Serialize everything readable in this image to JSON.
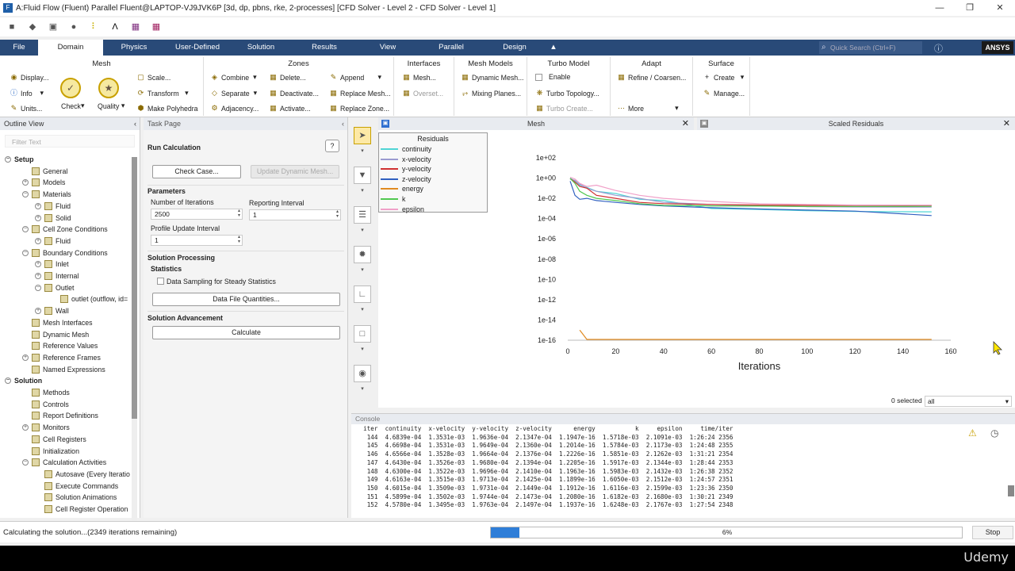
{
  "window": {
    "title": "A:Fluid Flow (Fluent) Parallel Fluent@LAPTOP-VJ9JVK6P  [3d, dp, pbns, rke, 2-processes] [CFD Solver - Level 2 - CFD Solver - Level 1]"
  },
  "tabs": [
    "File",
    "Domain",
    "Physics",
    "User-Defined",
    "Solution",
    "Results",
    "View",
    "Parallel",
    "Design"
  ],
  "active_tab": "Domain",
  "search_placeholder": "Quick Search (Ctrl+F)",
  "brand": "ANSYS",
  "ribbon": {
    "mesh": {
      "title": "Mesh",
      "display": "Display...",
      "info": "Info",
      "units": "Units...",
      "check": "Check",
      "quality": "Quality",
      "scale": "Scale...",
      "transform": "Transform",
      "make_polyhedra": "Make Polyhedra"
    },
    "zones": {
      "title": "Zones",
      "combine": "Combine",
      "separate": "Separate",
      "adjacency": "Adjacency...",
      "delete": "Delete...",
      "deactivate": "Deactivate...",
      "activate": "Activate...",
      "append": "Append",
      "replace_mesh": "Replace Mesh...",
      "replace_zone": "Replace Zone..."
    },
    "interfaces": {
      "title": "Interfaces",
      "mesh": "Mesh...",
      "overset": "Overset..."
    },
    "mesh_models": {
      "title": "Mesh Models",
      "dynamic_mesh": "Dynamic Mesh...",
      "mixing_planes": "Mixing Planes..."
    },
    "turbo": {
      "title": "Turbo Model",
      "enable": "Enable",
      "topology": "Turbo Topology...",
      "create": "Turbo Create..."
    },
    "adapt": {
      "title": "Adapt",
      "refine": "Refine / Coarsen...",
      "more": "More"
    },
    "surface": {
      "title": "Surface",
      "create": "Create",
      "manage": "Manage..."
    }
  },
  "outline": {
    "header": "Outline View",
    "filter_placeholder": "Filter Text",
    "items": [
      {
        "label": "Setup",
        "bold": true
      },
      {
        "label": "General"
      },
      {
        "label": "Models"
      },
      {
        "label": "Materials"
      },
      {
        "label": "Fluid"
      },
      {
        "label": "Solid"
      },
      {
        "label": "Cell Zone Conditions"
      },
      {
        "label": "Fluid"
      },
      {
        "label": "Boundary Conditions"
      },
      {
        "label": "Inlet"
      },
      {
        "label": "Internal"
      },
      {
        "label": "Outlet"
      },
      {
        "label": "outlet (outflow, id="
      },
      {
        "label": "Wall"
      },
      {
        "label": "Mesh Interfaces"
      },
      {
        "label": "Dynamic Mesh"
      },
      {
        "label": "Reference Values"
      },
      {
        "label": "Reference Frames"
      },
      {
        "label": "Named Expressions"
      },
      {
        "label": "Solution",
        "bold": true
      },
      {
        "label": "Methods"
      },
      {
        "label": "Controls"
      },
      {
        "label": "Report Definitions"
      },
      {
        "label": "Monitors"
      },
      {
        "label": "Cell Registers"
      },
      {
        "label": "Initialization"
      },
      {
        "label": "Calculation Activities"
      },
      {
        "label": "Autosave (Every Iteratio"
      },
      {
        "label": "Execute Commands"
      },
      {
        "label": "Solution Animations"
      },
      {
        "label": "Cell Register Operation"
      }
    ]
  },
  "task_page": {
    "header": "Task Page",
    "title": "Run Calculation",
    "check_case": "Check Case...",
    "update_dynamic_mesh": "Update Dynamic Mesh...",
    "parameters": "Parameters",
    "num_iterations_label": "Number of Iterations",
    "num_iterations": "2500",
    "reporting_interval_label": "Reporting Interval",
    "reporting_interval": "1",
    "profile_update_label": "Profile Update Interval",
    "profile_update": "1",
    "solution_processing": "Solution Processing",
    "statistics": "Statistics",
    "data_sampling": "Data Sampling for Steady Statistics",
    "data_file_quantities": "Data File Quantities...",
    "solution_advancement": "Solution Advancement",
    "calculate": "Calculate"
  },
  "mesh_tab": "Mesh",
  "residuals_tab": "Scaled Residuals",
  "legend_title": "Residuals",
  "selected_text": "0 selected",
  "selected_filter": "all",
  "chart_data": {
    "type": "line",
    "xlabel": "Iterations",
    "ylabel": "",
    "log_y": true,
    "xlim": [
      0,
      160
    ],
    "ylim_exp": [
      -16,
      2
    ],
    "xticks": [
      "0",
      "20",
      "40",
      "60",
      "80",
      "100",
      "120",
      "140",
      "160"
    ],
    "yticks": [
      "1e+02",
      "1e+00",
      "1e-02",
      "1e-04",
      "1e-06",
      "1e-08",
      "1e-10",
      "1e-12",
      "1e-14",
      "1e-16"
    ],
    "legend_position": "top-left",
    "series": [
      {
        "name": "continuity",
        "color": "#4fd5d5",
        "x": [
          1,
          3,
          5,
          8,
          12,
          20,
          30,
          40,
          60,
          80,
          100,
          120,
          152
        ],
        "y": [
          1.0,
          0.5,
          0.2,
          0.12,
          0.05,
          0.03,
          0.008,
          0.006,
          0.001,
          0.0008,
          0.0006,
          0.0005,
          0.00047
        ]
      },
      {
        "name": "x-velocity",
        "color": "#9b9bd0",
        "x": [
          1,
          3,
          5,
          8,
          12,
          20,
          30,
          40,
          60,
          80,
          100,
          120,
          152
        ],
        "y": [
          0.8,
          0.6,
          0.25,
          0.1,
          0.05,
          0.02,
          0.01,
          0.004,
          0.0025,
          0.0018,
          0.0015,
          0.0014,
          0.00135
        ]
      },
      {
        "name": "y-velocity",
        "color": "#d03030",
        "x": [
          1,
          3,
          5,
          8,
          12,
          20,
          30,
          40,
          60,
          80,
          100,
          120,
          152
        ],
        "y": [
          0.9,
          0.4,
          0.15,
          0.1,
          0.02,
          0.01,
          0.004,
          0.003,
          0.0025,
          0.0022,
          0.002,
          0.002,
          0.00198
        ]
      },
      {
        "name": "z-velocity",
        "color": "#3060c0",
        "x": [
          1,
          3,
          5,
          8,
          12,
          20,
          30,
          40,
          60,
          80,
          100,
          120,
          152
        ],
        "y": [
          0.5,
          0.02,
          0.008,
          0.01,
          0.006,
          0.004,
          0.0025,
          0.0018,
          0.0012,
          0.0009,
          0.0007,
          0.00055,
          0.0002
        ]
      },
      {
        "name": "energy",
        "color": "#e08a20",
        "x": [
          5,
          6,
          8,
          10,
          20,
          40,
          60,
          80,
          100,
          120,
          140,
          152
        ],
        "y": [
          1e-15,
          5e-16,
          1.2e-16,
          1.2e-16,
          1.2e-16,
          1.2e-16,
          1.2e-16,
          1.2e-16,
          1.2e-16,
          1.2e-16,
          1.2e-16,
          1.19e-16
        ]
      },
      {
        "name": "k",
        "color": "#50c850",
        "x": [
          1,
          3,
          5,
          8,
          12,
          20,
          30,
          40,
          60,
          80,
          100,
          120,
          152
        ],
        "y": [
          0.9,
          0.3,
          0.05,
          0.02,
          0.01,
          0.006,
          0.003,
          0.002,
          0.0018,
          0.0017,
          0.0016,
          0.0016,
          0.00162
        ]
      },
      {
        "name": "epsilon",
        "color": "#f0a0c8",
        "x": [
          1,
          3,
          5,
          8,
          12,
          20,
          30,
          40,
          60,
          80,
          100,
          120,
          152
        ],
        "y": [
          1.2,
          0.8,
          0.3,
          0.15,
          0.2,
          0.06,
          0.02,
          0.01,
          0.005,
          0.003,
          0.0025,
          0.0022,
          0.00218
        ]
      }
    ]
  },
  "console": {
    "header": "Console",
    "header_row": "  iter  continuity  x-velocity  y-velocity  z-velocity      energy           k     epsilon     time/iter",
    "rows": [
      "   144  4.6839e-04  1.3531e-03  1.9636e-04  2.1347e-04  1.1947e-16  1.5718e-03  2.1091e-03  1:26:24 2356",
      "   145  4.6698e-04  1.3531e-03  1.9649e-04  2.1360e-04  1.2014e-16  1.5784e-03  2.1173e-03  1:24:48 2355",
      "   146  4.6566e-04  1.3528e-03  1.9664e-04  2.1376e-04  1.2226e-16  1.5851e-03  2.1262e-03  1:31:21 2354",
      "   147  4.6430e-04  1.3526e-03  1.9680e-04  2.1394e-04  1.2205e-16  1.5917e-03  2.1344e-03  1:28:44 2353",
      "   148  4.6300e-04  1.3522e-03  1.9696e-04  2.1410e-04  1.1963e-16  1.5983e-03  2.1432e-03  1:26:38 2352",
      "   149  4.6163e-04  1.3515e-03  1.9713e-04  2.1425e-04  1.1899e-16  1.6050e-03  2.1512e-03  1:24:57 2351",
      "   150  4.6015e-04  1.3509e-03  1.9731e-04  2.1449e-04  1.1912e-16  1.6116e-03  2.1599e-03  1:23:36 2350",
      "   151  4.5899e-04  1.3502e-03  1.9744e-04  2.1473e-04  1.2080e-16  1.6182e-03  2.1680e-03  1:30:21 2349",
      "   152  4.5780e-04  1.3495e-03  1.9763e-04  2.1497e-04  1.1937e-16  1.6248e-03  2.1767e-03  1:27:54 2348"
    ]
  },
  "status": {
    "text": "Calculating the solution...(2349 iterations remaining)",
    "progress_label": "6%",
    "progress": 0.06,
    "stop": "Stop"
  },
  "watermark": "Udemy"
}
